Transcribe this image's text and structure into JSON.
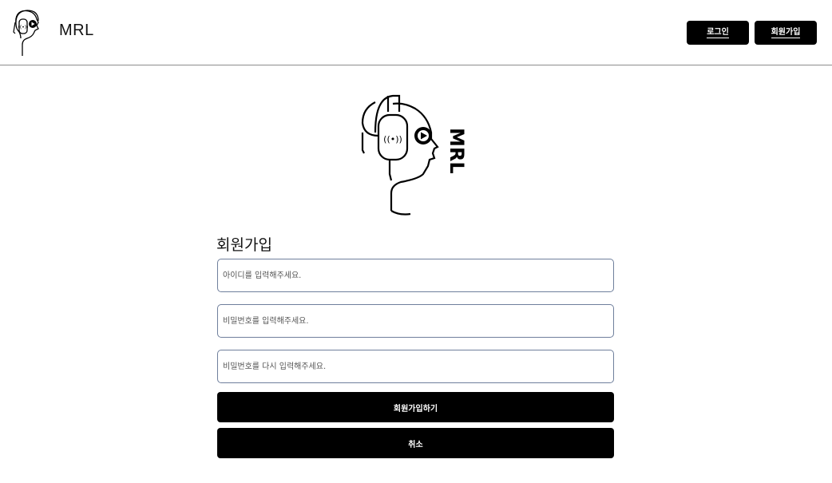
{
  "header": {
    "brand": "MRL",
    "login_label": "로그인",
    "signup_label": "회원가입"
  },
  "logo": {
    "text": "MRL"
  },
  "form": {
    "title": "회원가입",
    "id_placeholder": "아이디를 입력해주세요.",
    "password_placeholder": "비밀번호를 입력해주세요.",
    "password_confirm_placeholder": "비밀번호를 다시 입력해주세요.",
    "submit_label": "회원가입하기",
    "cancel_label": "취소"
  },
  "colors": {
    "accent": "#000000",
    "field_border": "#6f7f9c",
    "header_divider": "#8c8c8c"
  }
}
